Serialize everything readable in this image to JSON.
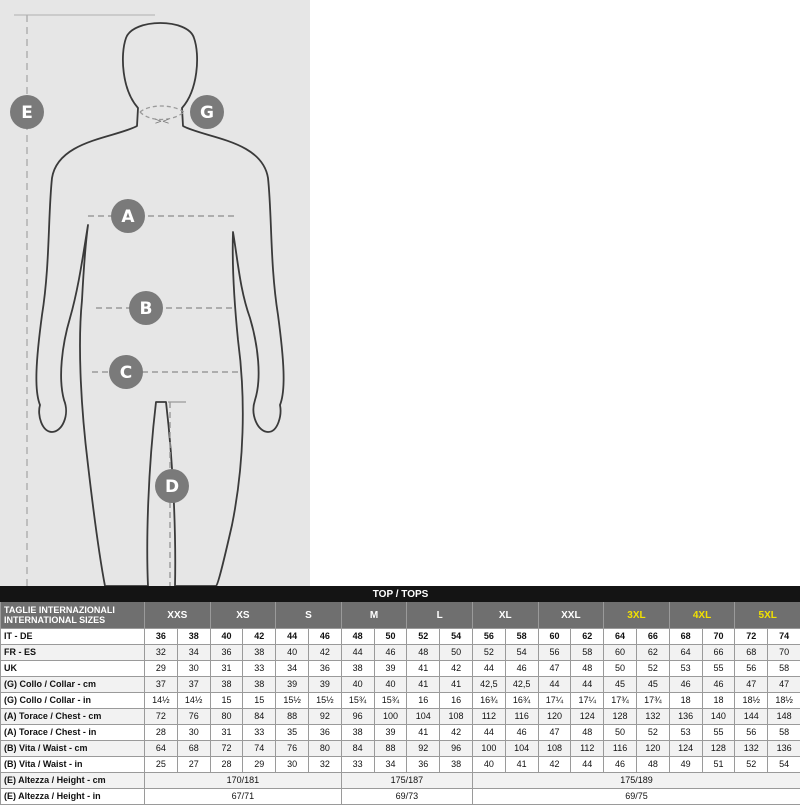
{
  "figure": {
    "markers": {
      "E": "E",
      "G": "G",
      "A": "A",
      "B": "B",
      "C": "C",
      "D": "D"
    }
  },
  "table": {
    "title": "TOP / TOPS",
    "header_label_line1": "TAGLIE INTERNAZIONALI",
    "header_label_line2": "INTERNATIONAL SIZES",
    "size_groups": [
      "XXS",
      "XS",
      "S",
      "M",
      "L",
      "XL",
      "XXL",
      "3XL",
      "4XL",
      "5XL"
    ],
    "highlight_color": "#f2e200",
    "rows": [
      {
        "label": "IT - DE",
        "cells": [
          "36",
          "38",
          "40",
          "42",
          "44",
          "46",
          "48",
          "50",
          "52",
          "54",
          "56",
          "58",
          "60",
          "62",
          "64",
          "66",
          "68",
          "70",
          "72",
          "74"
        ]
      },
      {
        "label": "FR - ES",
        "cells": [
          "32",
          "34",
          "36",
          "38",
          "40",
          "42",
          "44",
          "46",
          "48",
          "50",
          "52",
          "54",
          "56",
          "58",
          "60",
          "62",
          "64",
          "66",
          "68",
          "70"
        ]
      },
      {
        "label": "UK",
        "cells": [
          "29",
          "30",
          "31",
          "33",
          "34",
          "36",
          "38",
          "39",
          "41",
          "42",
          "44",
          "46",
          "47",
          "48",
          "50",
          "52",
          "53",
          "55",
          "56",
          "58"
        ]
      },
      {
        "label": "(G) Collo / Collar - cm",
        "cells": [
          "37",
          "37",
          "38",
          "38",
          "39",
          "39",
          "40",
          "40",
          "41",
          "41",
          "42,5",
          "42,5",
          "44",
          "44",
          "45",
          "45",
          "46",
          "46",
          "47",
          "47"
        ]
      },
      {
        "label": "(G) Collo / Collar - in",
        "cells": [
          "14½",
          "14½",
          "15",
          "15",
          "15½",
          "15½",
          "15¾",
          "15¾",
          "16",
          "16",
          "16¾",
          "16¾",
          "17¼",
          "17¼",
          "17¾",
          "17¾",
          "18",
          "18",
          "18½",
          "18½"
        ]
      },
      {
        "label": "(A) Torace / Chest - cm",
        "cells": [
          "72",
          "76",
          "80",
          "84",
          "88",
          "92",
          "96",
          "100",
          "104",
          "108",
          "112",
          "116",
          "120",
          "124",
          "128",
          "132",
          "136",
          "140",
          "144",
          "148"
        ]
      },
      {
        "label": "(A) Torace / Chest - in",
        "cells": [
          "28",
          "30",
          "31",
          "33",
          "35",
          "36",
          "38",
          "39",
          "41",
          "42",
          "44",
          "46",
          "47",
          "48",
          "50",
          "52",
          "53",
          "55",
          "56",
          "58"
        ]
      },
      {
        "label": "(B) Vita / Waist - cm",
        "cells": [
          "64",
          "68",
          "72",
          "74",
          "76",
          "80",
          "84",
          "88",
          "92",
          "96",
          "100",
          "104",
          "108",
          "112",
          "116",
          "120",
          "124",
          "128",
          "132",
          "136"
        ]
      },
      {
        "label": "(B) Vita / Waist - in",
        "cells": [
          "25",
          "27",
          "28",
          "29",
          "30",
          "32",
          "33",
          "34",
          "36",
          "38",
          "40",
          "41",
          "42",
          "44",
          "46",
          "48",
          "49",
          "51",
          "52",
          "54"
        ]
      }
    ],
    "height_cm": {
      "label": "(E) Altezza / Height - cm",
      "values": [
        "170/181",
        "175/187",
        "175/189"
      ]
    },
    "height_in": {
      "label": "(E) Altezza / Height - in",
      "values": [
        "67/71",
        "69/73",
        "69/75"
      ]
    }
  }
}
